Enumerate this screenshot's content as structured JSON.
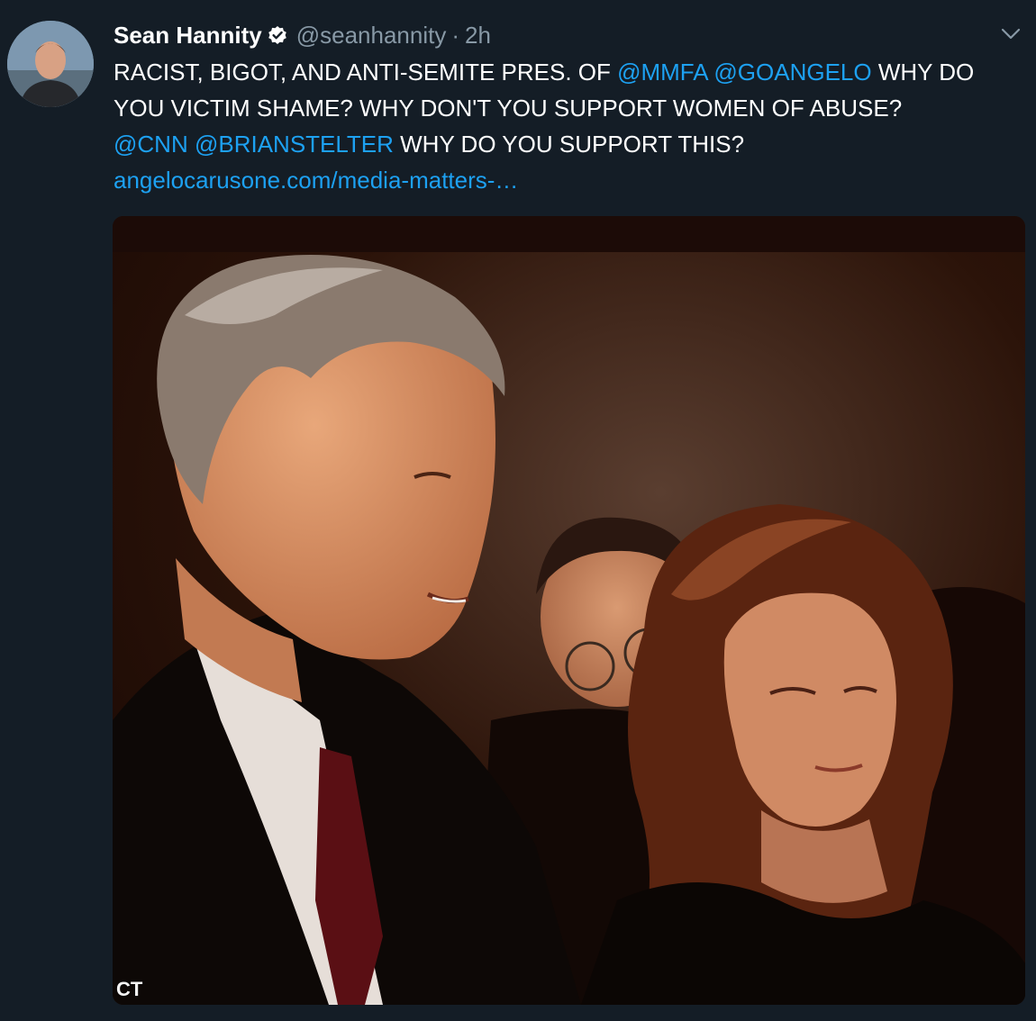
{
  "tweet": {
    "author": {
      "display_name": "Sean Hannity",
      "handle": "@seanhannity",
      "separator": "·",
      "time": "2h",
      "verified": true
    },
    "text": {
      "line1": {
        "part1": "RACIST, BIGOT, AND ANTI-SEMITE PRES. OF ",
        "mention1": "@MMFA",
        "space1": " ",
        "mention2": "@GOANGELO",
        "part2": " WHY DO"
      },
      "line2": "YOU VICTIM SHAME? WHY DON'T YOU SUPPORT WOMEN OF ABUSE?",
      "line3": {
        "mention1": "@CNN",
        "space1": " ",
        "mention2": "@BRIANSTELTER",
        "part1": " WHY DO YOU SUPPORT THIS?"
      },
      "link": "angelocarusone.com/media-matters-…"
    },
    "media": {
      "watermark": "CT"
    },
    "icons": {
      "verified": "verified-badge-icon",
      "caret": "chevron-down-icon"
    },
    "colors": {
      "background": "#141d26",
      "link": "#1da1f2",
      "secondary_text": "#8899a6"
    }
  }
}
